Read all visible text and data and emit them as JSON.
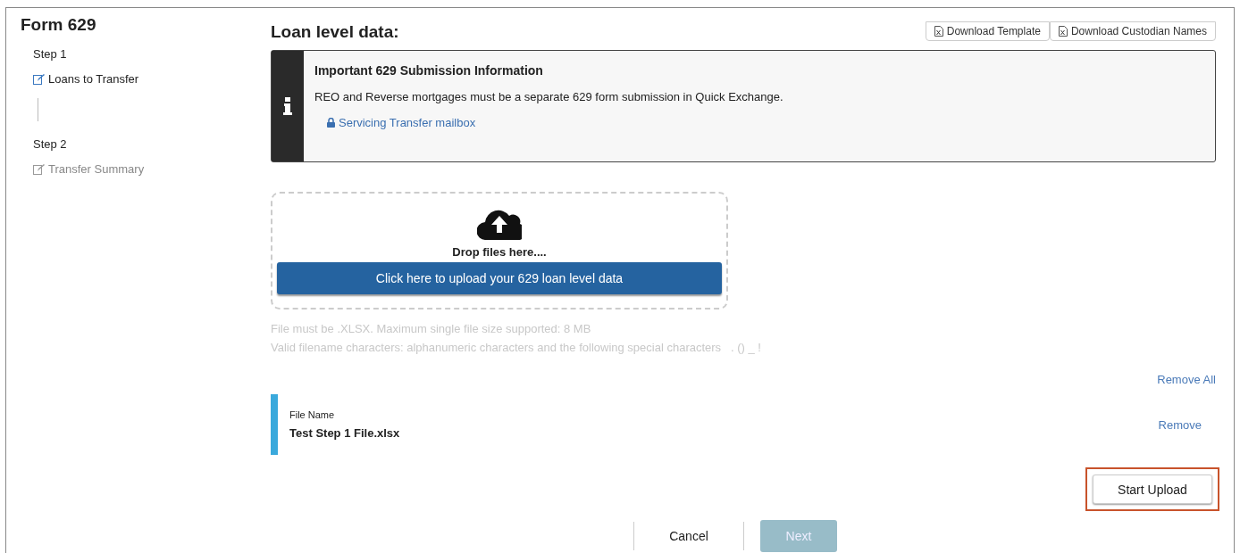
{
  "sidebar": {
    "title": "Form 629",
    "steps": [
      {
        "label": "Step 1",
        "link": "Loans to Transfer",
        "disabled": false
      },
      {
        "label": "Step 2",
        "link": "Transfer Summary",
        "disabled": true
      }
    ]
  },
  "main": {
    "title": "Loan level data:",
    "toolbar": [
      "Download Template",
      "Download Custodian Names"
    ],
    "notice": {
      "title": "Important 629 Submission Information",
      "text": "REO and Reverse mortgages must be a separate 629 form submission in Quick Exchange.",
      "link": "Servicing Transfer mailbox"
    },
    "dropzone": {
      "prompt": "Drop files here....",
      "button": "Click here to upload your 629 loan level data"
    },
    "hints": [
      "File must be .XLSX. Maximum single file size supported: 8 MB",
      "Valid filename characters: alphanumeric characters and the following special characters   . () _ !"
    ],
    "remove_all": "Remove All",
    "files": [
      {
        "label": "File Name",
        "name": "Test Step 1 File.xlsx",
        "action": "Remove"
      }
    ],
    "start_upload": {
      "label": "Start Upload",
      "highlighted": true
    },
    "footer": [
      {
        "label": "Cancel",
        "disabled": false,
        "kind": "plain"
      },
      {
        "label": "Next",
        "disabled": true,
        "kind": "primary"
      }
    ]
  }
}
